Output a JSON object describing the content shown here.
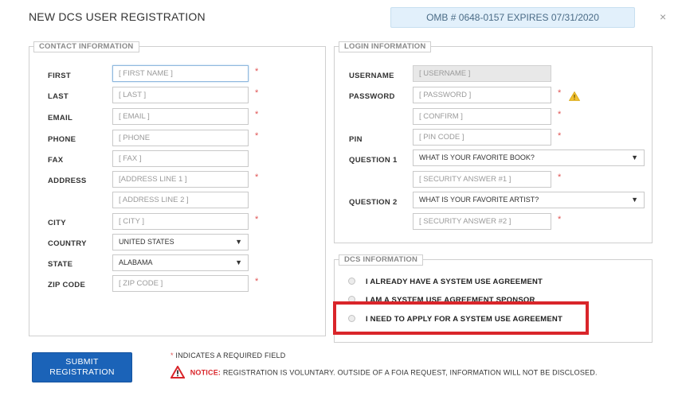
{
  "dialog": {
    "title": "NEW DCS USER REGISTRATION",
    "omb": "OMB # 0648-0157 EXPIRES 07/31/2020",
    "close_glyph": "×"
  },
  "contact": {
    "legend": "CONTACT INFORMATION",
    "first_label": "FIRST",
    "first_placeholder": "[ FIRST NAME ]",
    "last_label": "LAST",
    "last_placeholder": "[ LAST ]",
    "email_label": "EMAIL",
    "email_placeholder": "[ EMAIL ]",
    "phone_label": "PHONE",
    "phone_placeholder": "[ PHONE",
    "fax_label": "FAX",
    "fax_placeholder": "[ FAX ]",
    "address_label": "ADDRESS",
    "address1_placeholder": "[ADDRESS LINE 1 ]",
    "address2_placeholder": "[ ADDRESS LINE 2 ]",
    "city_label": "CITY",
    "city_placeholder": "[ CITY ]",
    "country_label": "COUNTRY",
    "country_value": "UNITED STATES",
    "state_label": "STATE",
    "state_value": "ALABAMA",
    "zip_label": "ZIP CODE",
    "zip_placeholder": "[ ZIP CODE ]"
  },
  "login": {
    "legend": "LOGIN INFORMATION",
    "username_label": "USERNAME",
    "username_placeholder": "[ USERNAME ]",
    "password_label": "PASSWORD",
    "password_placeholder": "[ PASSWORD ]",
    "confirm_placeholder": "[ CONFIRM ]",
    "pin_label": "PIN",
    "pin_placeholder": "[ PIN CODE ]",
    "question1_label": "QUESTION 1",
    "question1_value": "WHAT IS YOUR FAVORITE BOOK?",
    "answer1_placeholder": "[ SECURITY ANSWER #1 ]",
    "question2_label": "QUESTION 2",
    "question2_value": "WHAT IS YOUR FAVORITE ARTIST?",
    "answer2_placeholder": "[ SECURITY ANSWER #2 ]"
  },
  "dcs": {
    "legend": "DCS INFORMATION",
    "options": [
      "I ALREADY HAVE A SYSTEM USE AGREEMENT",
      "I AM A SYSTEM USE AGREEMENT SPONSOR",
      "I NEED TO APPLY FOR A SYSTEM USE AGREEMENT"
    ]
  },
  "footer": {
    "submit_line1": "SUBMIT",
    "submit_line2": "REGISTRATION",
    "required_star": "*",
    "required_note": "INDICATES A REQUIRED FIELD",
    "notice_key": "NOTICE:",
    "notice_text": "REGISTRATION IS VOLUNTARY. OUTSIDE OF A FOIA REQUEST, INFORMATION WILL NOT BE DISCLOSED."
  },
  "required_marker": "*",
  "dropdown_arrow": "▼",
  "colors": {
    "accent_blue": "#1b63b8",
    "required_red": "#e05353",
    "highlight_red": "#d9252a",
    "omb_bg": "#e2f0fb",
    "warning_yellow": "#f2c12e"
  },
  "icons": [
    "warning-icon",
    "close-icon",
    "dropdown-arrow-icon",
    "notice-warning-icon"
  ]
}
